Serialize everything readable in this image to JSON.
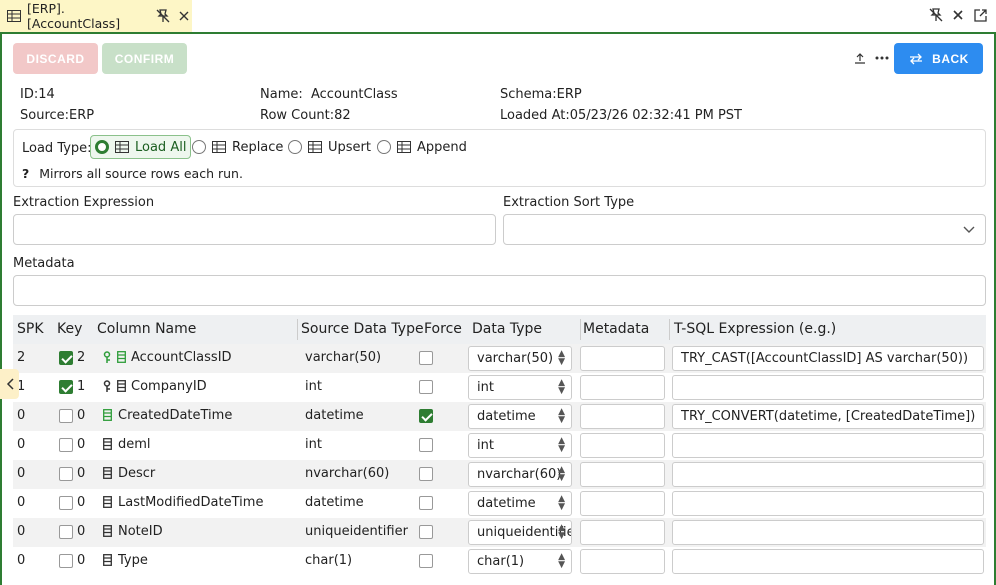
{
  "tab": {
    "title": "[ERP].[AccountClass]"
  },
  "toolbar": {
    "discard": "DISCARD",
    "confirm": "CONFIRM",
    "back": "BACK"
  },
  "info": {
    "id_label": "ID:",
    "id": "14",
    "name_label": "Name:",
    "name": "AccountClass",
    "schema_label": "Schema:",
    "schema": "ERP",
    "source_label": "Source:",
    "source": "ERP",
    "rowcount_label": "Row Count:",
    "rowcount": "82",
    "loaded_label": "Loaded At:",
    "loaded": "05/23/26 02:32:41 PM PST"
  },
  "load": {
    "label": "Load Type:",
    "options": [
      "Load All",
      "Replace",
      "Upsert",
      "Append"
    ],
    "selected": "Load All",
    "hint": "Mirrors all source rows each run.",
    "hint_icon": "?"
  },
  "fields": {
    "extraction_expression": "Extraction Expression",
    "extraction_sort_type": "Extraction Sort Type",
    "metadata": "Metadata"
  },
  "grid": {
    "headers": [
      "SPK",
      "Key",
      "Column Name",
      "Source Data Type",
      "Force",
      "Data Type",
      "Metadata",
      "T-SQL Expression (e.g.)"
    ],
    "rows": [
      {
        "spk": "2",
        "key_checked": true,
        "key": "2",
        "name": "AccountClassID",
        "src": "varchar(50)",
        "force": false,
        "dtype": "varchar(50)",
        "expr": "TRY_CAST([AccountClassID] AS varchar(50))",
        "icon": "key-green"
      },
      {
        "spk": "1",
        "key_checked": true,
        "key": "1",
        "name": "CompanyID",
        "src": "int",
        "force": false,
        "dtype": "int",
        "expr": "",
        "icon": "key-dark"
      },
      {
        "spk": "0",
        "key_checked": false,
        "key": "0",
        "name": "CreatedDateTime",
        "src": "datetime",
        "force": true,
        "dtype": "datetime",
        "expr": "TRY_CONVERT(datetime, [CreatedDateTime])",
        "icon": "col-green"
      },
      {
        "spk": "0",
        "key_checked": false,
        "key": "0",
        "name": "deml",
        "src": "int",
        "force": false,
        "dtype": "int",
        "expr": "",
        "icon": "col-dark"
      },
      {
        "spk": "0",
        "key_checked": false,
        "key": "0",
        "name": "Descr",
        "src": "nvarchar(60)",
        "force": false,
        "dtype": "nvarchar(60)",
        "expr": "",
        "icon": "col-dark"
      },
      {
        "spk": "0",
        "key_checked": false,
        "key": "0",
        "name": "LastModifiedDateTime",
        "src": "datetime",
        "force": false,
        "dtype": "datetime",
        "expr": "",
        "icon": "col-dark"
      },
      {
        "spk": "0",
        "key_checked": false,
        "key": "0",
        "name": "NoteID",
        "src": "uniqueidentifier",
        "force": false,
        "dtype": "uniqueidentifie",
        "expr": "",
        "icon": "col-dark"
      },
      {
        "spk": "0",
        "key_checked": false,
        "key": "0",
        "name": "Type",
        "src": "char(1)",
        "force": false,
        "dtype": "char(1)",
        "expr": "",
        "icon": "col-dark"
      }
    ]
  },
  "colors": {
    "accent": "#2e7d32",
    "primary": "#2d8cf0",
    "tab_bg": "#fdf6c6"
  }
}
